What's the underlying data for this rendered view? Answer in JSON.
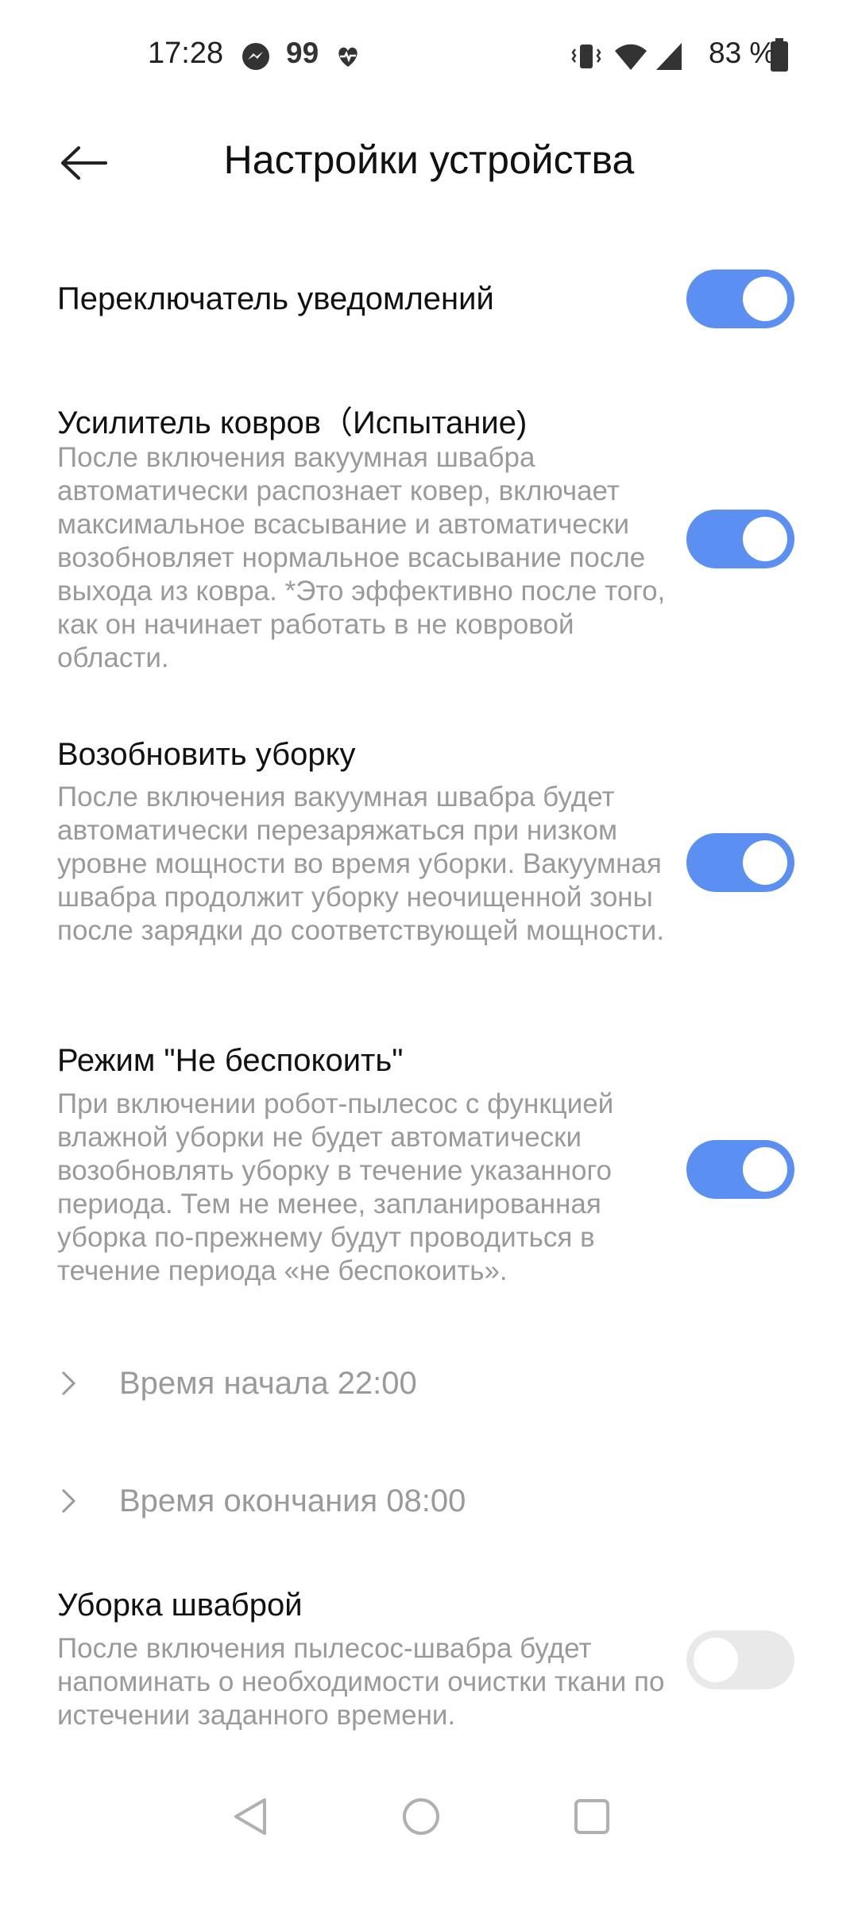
{
  "status_bar": {
    "time": "17:28",
    "messenger_icon": "messenger-icon",
    "notification_count": "99",
    "battery_percent": "83 %"
  },
  "header": {
    "title": "Настройки устройства",
    "back_icon": "back-arrow-icon"
  },
  "settings": {
    "notifications": {
      "title": "Переключатель уведомлений",
      "enabled": true
    },
    "carpet_boost": {
      "title": "Усилитель ковров（Испытание)",
      "description": "После включения вакуумная швабра автоматически распознает ковер, включает максимальное всасывание и автоматически возобновляет нормальное всасывание после выхода из ковра. *Это эффективно после того, как он начинает работать в не ковровой области.",
      "enabled": true
    },
    "resume_cleaning": {
      "title": "Возобновить уборку",
      "description": "После включения вакуумная швабра будет автоматически перезаряжаться при низком уровне мощности во время уборки. Вакуумная швабра продолжит уборку неочищенной зоны после зарядки до соответствующей мощности.",
      "enabled": true
    },
    "dnd": {
      "title": "Режим \"Не беспокоить\"",
      "description": "При включении робот-пылесос с функцией влажной уборки не будет автоматически возобновлять уборку в течение указанного периода. Тем не менее, запланированная уборка по-прежнему будут проводиться в течение периода «не беспокоить».",
      "enabled": true,
      "start_time": "Время начала 22:00",
      "end_time": "Время окончания 08:00"
    },
    "mop_cleaning": {
      "title": "Уборка шваброй",
      "description": "После включения пылесос-швабра будет напоминать о необходимости очистки ткани по истечении заданного времени.",
      "enabled": false
    }
  },
  "nav_bar": {
    "back": "nav-back-icon",
    "home": "nav-home-icon",
    "recents": "nav-recents-icon"
  },
  "colors": {
    "accent": "#5b8ff2",
    "secondary_text": "#9a9a9a",
    "toggle_off": "#e9e9e9"
  }
}
